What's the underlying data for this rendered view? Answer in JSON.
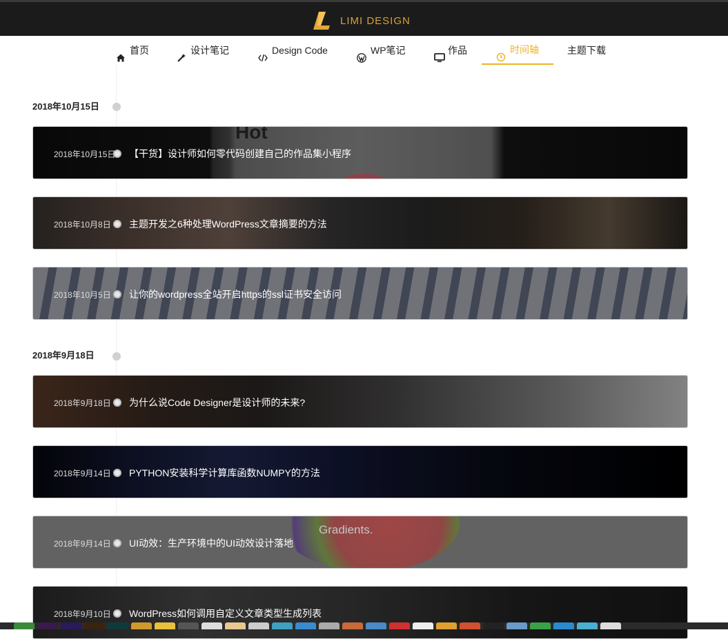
{
  "header": {
    "brand": "LIMI DESIGN",
    "logo_icon": "limi-logo-icon"
  },
  "nav": {
    "items": [
      {
        "label": "首页",
        "icon": "home-icon"
      },
      {
        "label": "设计笔记",
        "icon": "magic-wand-icon"
      },
      {
        "label": "Design Code",
        "icon": "code-icon"
      },
      {
        "label": "WP笔记",
        "icon": "wordpress-icon"
      },
      {
        "label": "作品",
        "icon": "monitor-icon"
      },
      {
        "label": "时间轴",
        "icon": "clock-icon",
        "active": true
      },
      {
        "label": "主题下载",
        "icon": ""
      }
    ],
    "accent": "#f0b323"
  },
  "groups": [
    {
      "date": "2018年10月15日",
      "posts": [
        {
          "date": "2018年10月15日",
          "title": "【干货】设计师如何零代码创建自己的作品集小程序",
          "bg_text": "Hot"
        },
        {
          "date": "2018年10月8日",
          "title": "主题开发之6种处理WordPress文章摘要的方法"
        },
        {
          "date": "2018年10月5日",
          "title": "让你的wordpress全站开启https的ssl证书安全访问"
        }
      ]
    },
    {
      "date": "2018年9月18日",
      "posts": [
        {
          "date": "2018年9月18日",
          "title": "为什么说Code Designer是设计师的未来?"
        },
        {
          "date": "2018年9月14日",
          "title": "PYTHON安装科学计算库函数NUMPY的方法"
        },
        {
          "date": "2018年9月14日",
          "title": "UI动效：生产环境中的UI动效设计落地",
          "bg_text": "Gradients."
        },
        {
          "date": "2018年9月10日",
          "title": "WordPress如何调用自定义文章类型生成列表"
        }
      ]
    }
  ]
}
